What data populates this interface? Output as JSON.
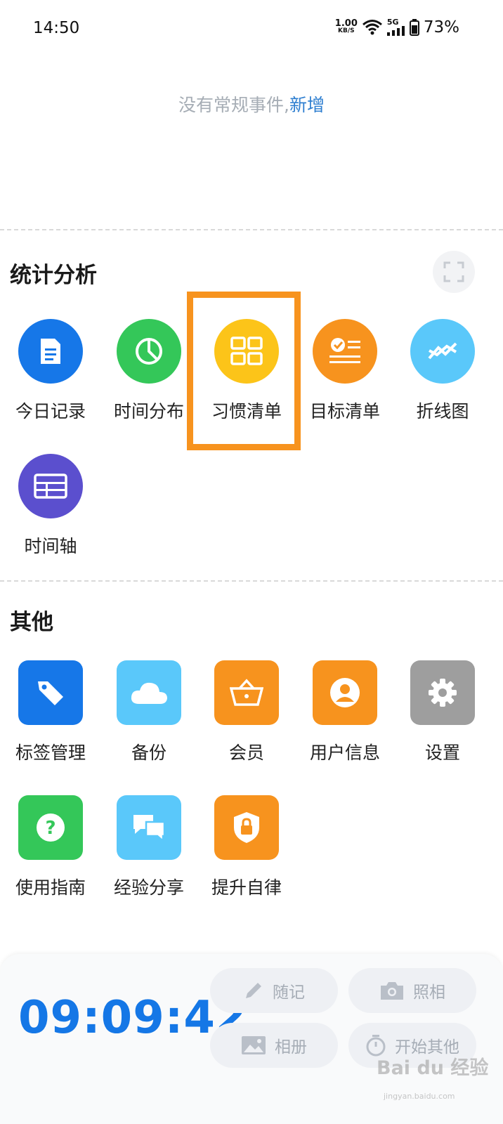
{
  "status_bar": {
    "time": "14:50",
    "net_speed_value": "1.00",
    "net_speed_unit": "KB/S",
    "network_type": "5G",
    "battery": "73%"
  },
  "events": {
    "empty_text": "没有常规事件,",
    "add_link": "新增"
  },
  "stats": {
    "title": "统计分析",
    "items": [
      {
        "label": "今日记录",
        "color": "#1677e8",
        "icon": "document-icon"
      },
      {
        "label": "时间分布",
        "color": "#34c759",
        "icon": "pie-chart-icon"
      },
      {
        "label": "习惯清单",
        "color": "#fcc419",
        "icon": "grid-icon"
      },
      {
        "label": "目标清单",
        "color": "#f7931e",
        "icon": "checklist-icon"
      },
      {
        "label": "折线图",
        "color": "#5ac8fa",
        "icon": "trend-line-icon"
      },
      {
        "label": "时间轴",
        "color": "#5b4fce",
        "icon": "table-icon"
      }
    ]
  },
  "others": {
    "title": "其他",
    "items": [
      {
        "label": "标签管理",
        "color": "#1677e8",
        "icon": "tag-icon"
      },
      {
        "label": "备份",
        "color": "#5ac8fa",
        "icon": "cloud-icon"
      },
      {
        "label": "会员",
        "color": "#f7931e",
        "icon": "basket-icon"
      },
      {
        "label": "用户信息",
        "color": "#f7931e",
        "icon": "user-icon"
      },
      {
        "label": "设置",
        "color": "#9e9e9e",
        "icon": "gear-icon"
      },
      {
        "label": "使用指南",
        "color": "#34c759",
        "icon": "help-icon"
      },
      {
        "label": "经验分享",
        "color": "#5ac8fa",
        "icon": "chat-icon"
      },
      {
        "label": "提升自律",
        "color": "#f7931e",
        "icon": "lock-shield-icon"
      }
    ]
  },
  "bottom": {
    "timer": "09:09:42",
    "actions": [
      {
        "label": "随记",
        "icon": "pencil-icon"
      },
      {
        "label": "照相",
        "icon": "camera-icon"
      },
      {
        "label": "相册",
        "icon": "image-icon"
      },
      {
        "label": "开始其他",
        "icon": "stopwatch-icon"
      }
    ]
  },
  "watermark": {
    "text": "Bai du 经验",
    "sub": "jingyan.baidu.com"
  }
}
